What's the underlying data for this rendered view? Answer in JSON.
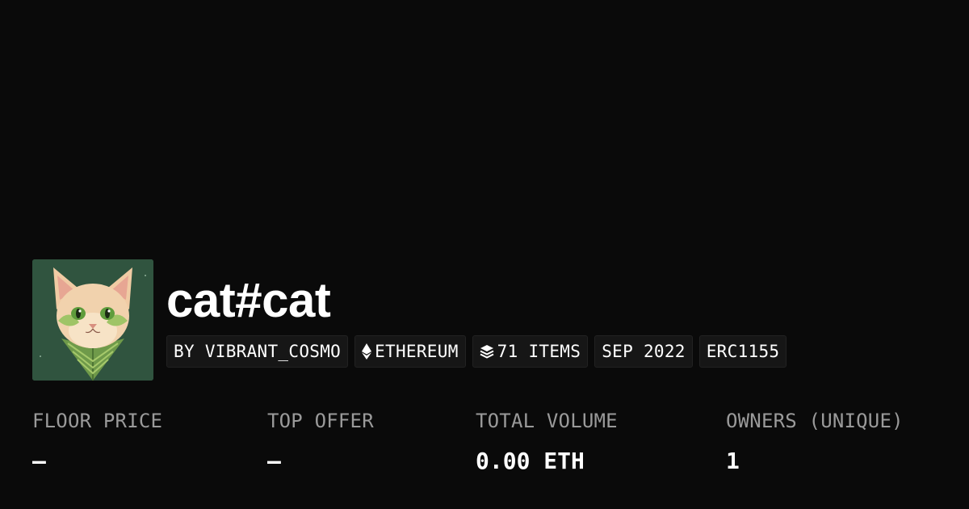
{
  "collection": {
    "name": "cat#cat",
    "avatar_alt": "cat illustration"
  },
  "chips": [
    {
      "icon": "",
      "label": "BY VIBRANT_COSMO"
    },
    {
      "icon": "ethereum-icon",
      "label": "ETHEREUM"
    },
    {
      "icon": "layers-icon",
      "label": "71 ITEMS"
    },
    {
      "icon": "",
      "label": "SEP 2022"
    },
    {
      "icon": "",
      "label": "ERC1155"
    }
  ],
  "stats": [
    {
      "label": "FLOOR PRICE",
      "value": "–"
    },
    {
      "label": "TOP OFFER",
      "value": "–"
    },
    {
      "label": "TOTAL VOLUME",
      "value": "0.00 ETH"
    },
    {
      "label": "OWNERS (UNIQUE)",
      "value": "1"
    }
  ],
  "colors": {
    "background": "#0a0a0a",
    "chip_background": "#161616",
    "label": "#9a9a9a",
    "value": "#ffffff"
  }
}
